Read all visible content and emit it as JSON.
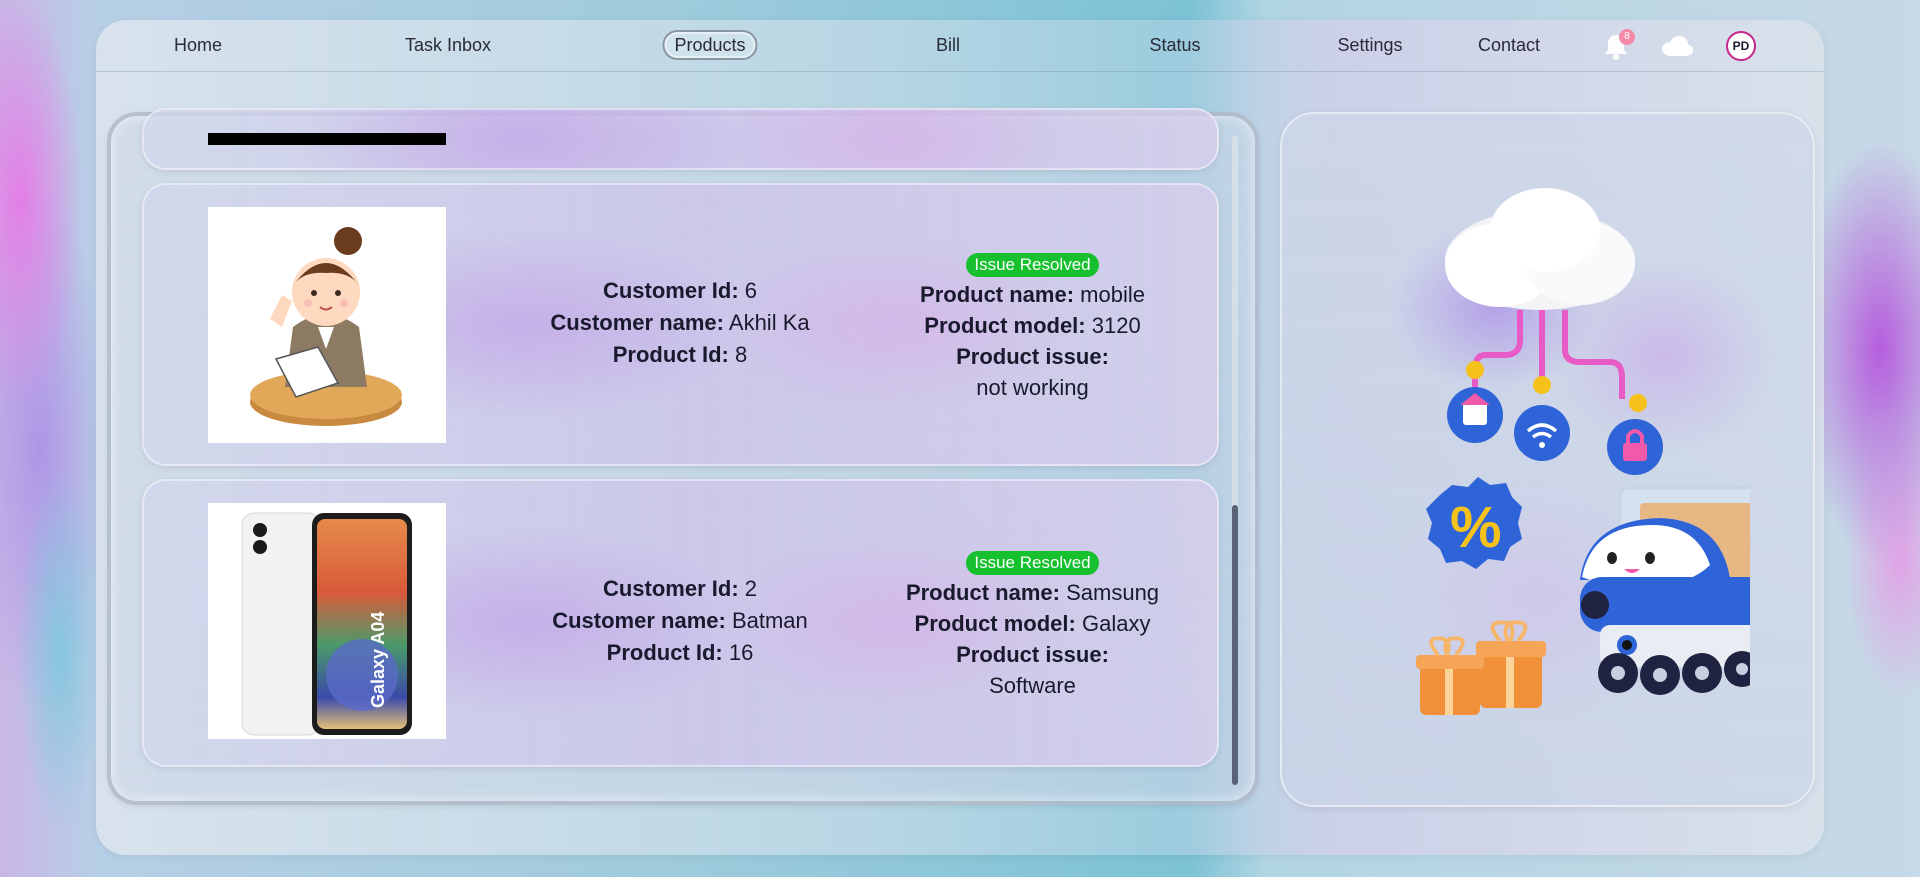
{
  "nav": {
    "home": "Home",
    "task_inbox": "Task Inbox",
    "products": "Products",
    "bill": "Bill",
    "status": "Status",
    "settings": "Settings",
    "contact": "Contact",
    "notification_count": "8",
    "avatar_initials": "PD",
    "icons": [
      "bell-icon",
      "cloud-icon",
      "avatar"
    ]
  },
  "labels": {
    "customer_id": "Customer Id:",
    "customer_name": "Customer name:",
    "product_id": "Product Id:",
    "product_name": "Product name:",
    "product_model": "Product model:",
    "product_issue": "Product issue:"
  },
  "cards": [
    {
      "status": "Issue Resolved",
      "customer_id": "6",
      "customer_name": "Akhil Ka",
      "product_id": "8",
      "product_name": "mobile",
      "product_model": "3120",
      "product_issue": "not working",
      "image": "cartoon-woman-reading-document"
    },
    {
      "status": "Issue Resolved",
      "customer_id": "2",
      "customer_name": "Batman",
      "product_id": "16",
      "product_name": "Samsung",
      "product_model": "Galaxy",
      "product_issue": "Software",
      "image": "samsung-galaxy-a04-phone",
      "image_text": "Galaxy A04"
    }
  ],
  "colors": {
    "status_badge": "#16c02e",
    "avatar_ring": "#c7278b",
    "notification_badge": "#f48aa8",
    "scroll_thumb": "#5a6276"
  },
  "illustration": "cloud-delivery-robot-illustration"
}
